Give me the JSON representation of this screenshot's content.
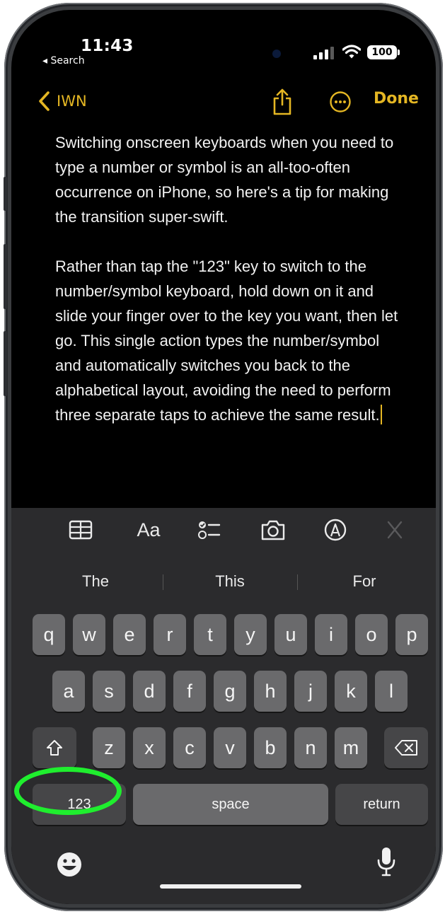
{
  "status_bar": {
    "time": "11:43",
    "back_app": "◂ Search",
    "battery": "100"
  },
  "nav": {
    "back_label": "IWN",
    "done_label": "Done"
  },
  "note": {
    "paragraph_1": "Switching onscreen keyboards when you need to type a number or symbol is an all-too-often occurrence on iPhone, so here's a tip for making the transition super-swift.",
    "paragraph_2": "Rather than tap the \"123\" key to switch to the number/symbol keyboard, hold down on it and slide your finger over to the key you want, then let go. This single action types the number/symbol and automatically switches you back to the alphabetical layout, avoiding the need to perform three separate taps to achieve the same result."
  },
  "keyboard_toolbar": {
    "format_label": "Aa",
    "icons": [
      "table-icon",
      "text-format-icon",
      "checklist-icon",
      "camera-icon",
      "markup-pen-icon",
      "close-icon"
    ]
  },
  "suggestions": [
    "The",
    "This",
    "For"
  ],
  "keys": {
    "row1": [
      "q",
      "w",
      "e",
      "r",
      "t",
      "y",
      "u",
      "i",
      "o",
      "p"
    ],
    "row2": [
      "a",
      "s",
      "d",
      "f",
      "g",
      "h",
      "j",
      "k",
      "l"
    ],
    "row3": [
      "z",
      "x",
      "c",
      "v",
      "b",
      "n",
      "m"
    ],
    "numbers": "123",
    "space": "space",
    "return": "return"
  },
  "colors": {
    "accent": "#e4b623",
    "highlight": "#1fee2e",
    "keyboard_bg": "#2b2b2d",
    "key_bg": "#6a6a6c"
  }
}
